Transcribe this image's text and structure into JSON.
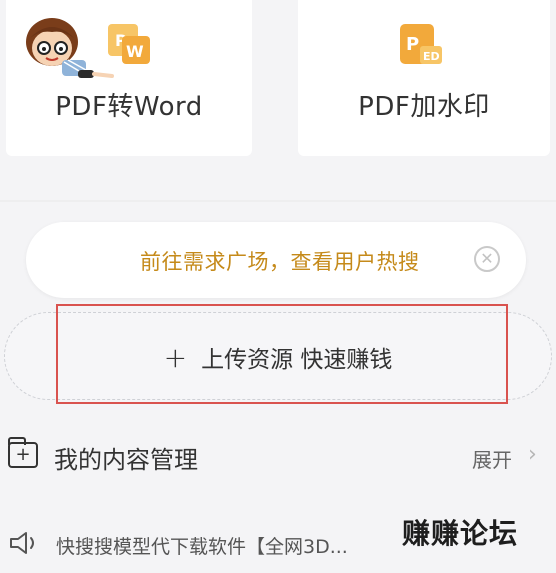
{
  "tools": [
    {
      "label": "PDF转Word",
      "icon": "pdf-to-word-icon"
    },
    {
      "label": "PDF加水印",
      "icon": "pdf-watermark-icon"
    }
  ],
  "promo": {
    "text": "前往需求广场，查看用户热搜",
    "close_icon": "close-icon"
  },
  "upload": {
    "plus": "+",
    "label": "上传资源 快速赚钱"
  },
  "my_content": {
    "title": "我的内容管理",
    "expand_label": "展开",
    "chevron": "›"
  },
  "notice": {
    "text": "快搜搜模型代下载软件【全网3D..."
  },
  "watermark": {
    "text": "赚赚论坛"
  },
  "colors": {
    "accent": "#c58a1a",
    "highlight_border": "#d9534f",
    "icon_orange": "#f2a93b"
  }
}
